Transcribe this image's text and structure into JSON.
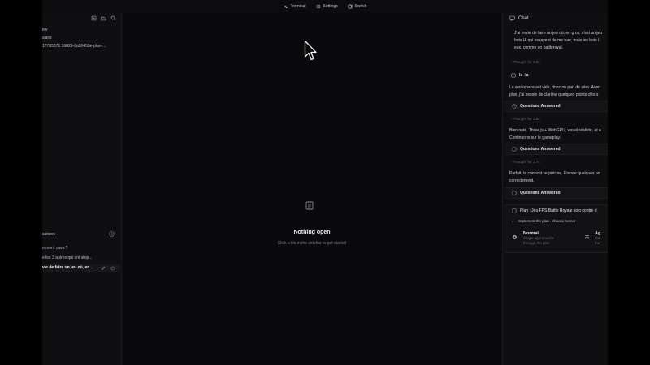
{
  "topbar": {
    "items": [
      {
        "label": "Terminal",
        "icon": "terminal-icon"
      },
      {
        "label": "Settings",
        "icon": "gear-icon"
      },
      {
        "label": "Switch",
        "icon": "switch-icon"
      }
    ]
  },
  "sidebar": {
    "tree": [
      "ew",
      "sians",
      "17785371 16829-8a50455e-plan-..."
    ],
    "conversations_header": "sations",
    "conversations": [
      "mment cava ?",
      "e les 3 autres qui ont stop...",
      "vie de faire un jeu où, en ..."
    ]
  },
  "editor": {
    "empty_title": "Nothing open",
    "empty_subtitle": "Click a file in the sidebar to get started"
  },
  "chat": {
    "title": "Chat",
    "msg1": [
      "J'ai envie de faire un jeu où, en gros, c'est un jeu",
      "bots IA qui essayent de me tuer, mais les bots l",
      "eux, comme un battleroyal."
    ],
    "thought1": "Thought for 3.0s",
    "tool_ls": "ls -la",
    "msg2": [
      "Le workspace est vide, donc on part de zéro. Avan",
      "plan, j'ai besoin de clarifier quelques points clés s"
    ],
    "qa_label": "Questions Answered",
    "thought2": "Thought for 1.8s",
    "msg3": [
      "Bien noté. Three.js + WebGPU, visuel réaliste, et o",
      "Continuons sur le gameplay."
    ],
    "thought3": "Thought for 1.7s",
    "msg4": [
      "Parfait, le concept se précise. Encore quelques po",
      "correctement."
    ],
    "plan": {
      "title": "Plan : Jeu FPS Battle Royale solo contre d",
      "subtitle": "Implement the plan · choose runner",
      "options": [
        {
          "title": "Normal",
          "desc": [
            "Single agent works",
            "through the plan"
          ]
        },
        {
          "title": "Ag",
          "desc": [
            "Mu",
            "the"
          ]
        }
      ]
    }
  }
}
